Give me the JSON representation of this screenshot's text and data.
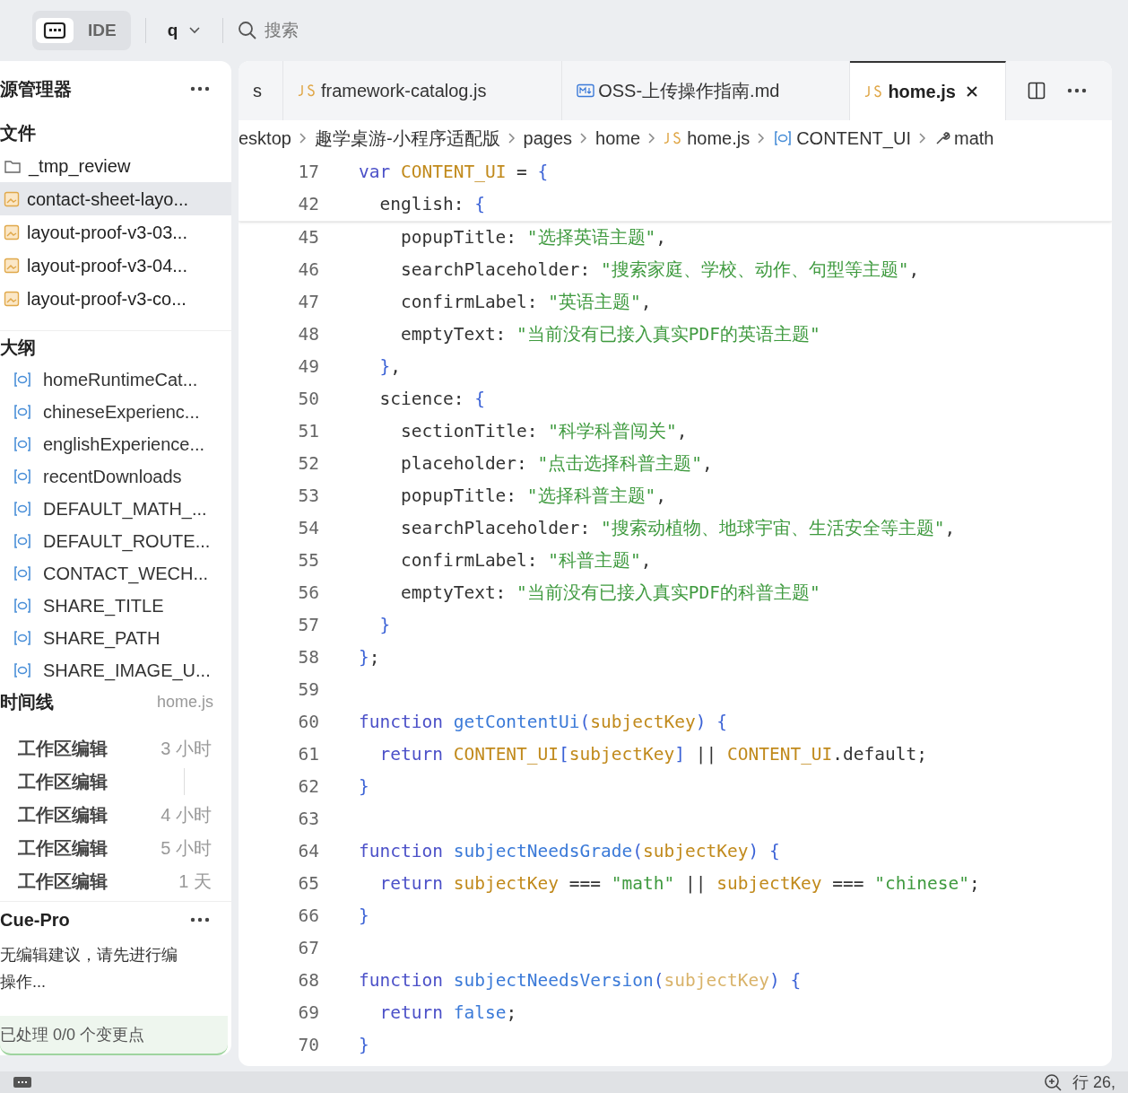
{
  "topbar": {
    "modes": [
      {
        "kind": "terminal",
        "selected": true
      },
      {
        "kind": "text",
        "label": "IDE",
        "selected": false
      }
    ],
    "workspace": "q",
    "search_placeholder": "搜索"
  },
  "explorer": {
    "title": "源管理器",
    "files_title": "文件",
    "files": [
      {
        "name": "_tmp_review",
        "kind": "folder",
        "selected": false
      },
      {
        "name": "contact-sheet-layo...",
        "kind": "image",
        "selected": true
      },
      {
        "name": "layout-proof-v3-03...",
        "kind": "image",
        "selected": false
      },
      {
        "name": "layout-proof-v3-04...",
        "kind": "image",
        "selected": false
      },
      {
        "name": "layout-proof-v3-co...",
        "kind": "image",
        "selected": false
      }
    ]
  },
  "outline": {
    "title": "大纲",
    "items": [
      "homeRuntimeCat...",
      "chineseExperienc...",
      "englishExperience...",
      "recentDownloads",
      "DEFAULT_MATH_...",
      "DEFAULT_ROUTE...",
      "CONTACT_WECH...",
      "SHARE_TITLE",
      "SHARE_PATH",
      "SHARE_IMAGE_U..."
    ]
  },
  "timeline": {
    "title": "时间线",
    "file": "home.js",
    "entries": [
      {
        "label": "工作区编辑",
        "time": "3 小时"
      },
      {
        "label": "工作区编辑"
      },
      {
        "label": "工作区编辑",
        "time": "4 小时"
      },
      {
        "label": "工作区编辑",
        "time": "5 小时"
      },
      {
        "label": "工作区编辑",
        "time": "1 天"
      }
    ]
  },
  "cue": {
    "title": "Cue-Pro",
    "message_lines": [
      "无编辑建议，请先进行编",
      "操作..."
    ],
    "status": "已处理 0/0 个变更点"
  },
  "tabs": [
    {
      "label": "s",
      "kind": "partial",
      "selected": false
    },
    {
      "label": "framework-catalog.js",
      "kind": "js",
      "selected": false
    },
    {
      "label": "OSS-上传操作指南.md",
      "kind": "md",
      "selected": false
    },
    {
      "label": "home.js",
      "kind": "js",
      "selected": true
    }
  ],
  "breadcrumb": [
    {
      "label": "esktop",
      "kind": "folder"
    },
    {
      "label": "趣学桌游-小程序适配版",
      "kind": "folder"
    },
    {
      "label": "pages",
      "kind": "folder"
    },
    {
      "label": "home",
      "kind": "folder"
    },
    {
      "label": "home.js",
      "kind": "js"
    },
    {
      "label": "CONTENT_UI",
      "kind": "variable"
    },
    {
      "label": "math",
      "kind": "property"
    }
  ],
  "sticky_lines": [
    {
      "n": "17",
      "t": [
        {
          "kind": "keyword",
          "text": "var "
        },
        {
          "kind": "constant",
          "text": "CONTENT_UI"
        },
        {
          "kind": "plain",
          "text": " = "
        },
        {
          "kind": "bracket",
          "text": "{"
        }
      ]
    },
    {
      "n": "42",
      "t": [
        {
          "kind": "plain",
          "text": "  english: "
        },
        {
          "kind": "bracket",
          "text": "{"
        }
      ]
    }
  ],
  "lines": [
    {
      "n": "45",
      "t": [
        {
          "kind": "plain",
          "text": "    popupTitle: "
        },
        {
          "kind": "string",
          "text": "\"选择英语主题\""
        },
        {
          "kind": "plain",
          "text": ","
        }
      ]
    },
    {
      "n": "46",
      "t": [
        {
          "kind": "plain",
          "text": "    searchPlaceholder: "
        },
        {
          "kind": "string",
          "text": "\"搜索家庭、学校、动作、句型等主题\""
        },
        {
          "kind": "plain",
          "text": ","
        }
      ]
    },
    {
      "n": "47",
      "t": [
        {
          "kind": "plain",
          "text": "    confirmLabel: "
        },
        {
          "kind": "string",
          "text": "\"英语主题\""
        },
        {
          "kind": "plain",
          "text": ","
        }
      ]
    },
    {
      "n": "48",
      "t": [
        {
          "kind": "plain",
          "text": "    emptyText: "
        },
        {
          "kind": "string",
          "text": "\"当前没有已接入真实PDF的英语主题\""
        }
      ]
    },
    {
      "n": "49",
      "t": [
        {
          "kind": "bracket",
          "text": "  }"
        },
        {
          "kind": "plain",
          "text": ","
        }
      ]
    },
    {
      "n": "50",
      "t": [
        {
          "kind": "plain",
          "text": "  science: "
        },
        {
          "kind": "bracket",
          "text": "{"
        }
      ]
    },
    {
      "n": "51",
      "t": [
        {
          "kind": "plain",
          "text": "    sectionTitle: "
        },
        {
          "kind": "string",
          "text": "\"科学科普闯关\""
        },
        {
          "kind": "plain",
          "text": ","
        }
      ]
    },
    {
      "n": "52",
      "t": [
        {
          "kind": "plain",
          "text": "    placeholder: "
        },
        {
          "kind": "string",
          "text": "\"点击选择科普主题\""
        },
        {
          "kind": "plain",
          "text": ","
        }
      ]
    },
    {
      "n": "53",
      "t": [
        {
          "kind": "plain",
          "text": "    popupTitle: "
        },
        {
          "kind": "string",
          "text": "\"选择科普主题\""
        },
        {
          "kind": "plain",
          "text": ","
        }
      ]
    },
    {
      "n": "54",
      "t": [
        {
          "kind": "plain",
          "text": "    searchPlaceholder: "
        },
        {
          "kind": "string",
          "text": "\"搜索动植物、地球宇宙、生活安全等主题\""
        },
        {
          "kind": "plain",
          "text": ","
        }
      ]
    },
    {
      "n": "55",
      "t": [
        {
          "kind": "plain",
          "text": "    confirmLabel: "
        },
        {
          "kind": "string",
          "text": "\"科普主题\""
        },
        {
          "kind": "plain",
          "text": ","
        }
      ]
    },
    {
      "n": "56",
      "t": [
        {
          "kind": "plain",
          "text": "    emptyText: "
        },
        {
          "kind": "string",
          "text": "\"当前没有已接入真实PDF的科普主题\""
        }
      ]
    },
    {
      "n": "57",
      "t": [
        {
          "kind": "bracket",
          "text": "  }"
        }
      ]
    },
    {
      "n": "58",
      "t": [
        {
          "kind": "bracket",
          "text": "}"
        },
        {
          "kind": "plain",
          "text": ";"
        }
      ]
    },
    {
      "n": "59"
    },
    {
      "n": "60",
      "t": [
        {
          "kind": "keyword",
          "text": "function "
        },
        {
          "kind": "function",
          "text": "getContentUi"
        },
        {
          "kind": "bracket",
          "text": "("
        },
        {
          "kind": "constant",
          "text": "subjectKey"
        },
        {
          "kind": "bracket",
          "text": ")"
        },
        {
          "kind": "bracket",
          "text": " {"
        }
      ]
    },
    {
      "n": "61",
      "t": [
        {
          "kind": "keyword",
          "text": "  return "
        },
        {
          "kind": "constant",
          "text": "CONTENT_UI"
        },
        {
          "kind": "bracket",
          "text": "["
        },
        {
          "kind": "constant",
          "text": "subjectKey"
        },
        {
          "kind": "bracket",
          "text": "]"
        },
        {
          "kind": "plain",
          "text": " || "
        },
        {
          "kind": "constant",
          "text": "CONTENT_UI"
        },
        {
          "kind": "plain",
          "text": ".default;"
        }
      ]
    },
    {
      "n": "62",
      "t": [
        {
          "kind": "bracket",
          "text": "}"
        }
      ]
    },
    {
      "n": "63"
    },
    {
      "n": "64",
      "t": [
        {
          "kind": "keyword",
          "text": "function "
        },
        {
          "kind": "function",
          "text": "subjectNeedsGrade"
        },
        {
          "kind": "bracket",
          "text": "("
        },
        {
          "kind": "constant",
          "text": "subjectKey"
        },
        {
          "kind": "bracket",
          "text": ")"
        },
        {
          "kind": "bracket",
          "text": " {"
        }
      ]
    },
    {
      "n": "65",
      "t": [
        {
          "kind": "keyword",
          "text": "  return "
        },
        {
          "kind": "constant",
          "text": "subjectKey"
        },
        {
          "kind": "plain",
          "text": " === "
        },
        {
          "kind": "string",
          "text": "\"math\""
        },
        {
          "kind": "plain",
          "text": " || "
        },
        {
          "kind": "constant",
          "text": "subjectKey"
        },
        {
          "kind": "plain",
          "text": " === "
        },
        {
          "kind": "string",
          "text": "\"chinese\""
        },
        {
          "kind": "plain",
          "text": ";"
        }
      ]
    },
    {
      "n": "66",
      "t": [
        {
          "kind": "bracket",
          "text": "}"
        }
      ]
    },
    {
      "n": "67"
    },
    {
      "n": "68",
      "t": [
        {
          "kind": "keyword",
          "text": "function "
        },
        {
          "kind": "function",
          "text": "subjectNeedsVersion"
        },
        {
          "kind": "bracket",
          "text": "("
        },
        {
          "kind": "unused",
          "text": "subjectKey"
        },
        {
          "kind": "bracket",
          "text": ")"
        },
        {
          "kind": "bracket",
          "text": " {"
        }
      ]
    },
    {
      "n": "69",
      "t": [
        {
          "kind": "keyword",
          "text": "  return "
        },
        {
          "kind": "literal",
          "text": "false"
        },
        {
          "kind": "plain",
          "text": ";"
        }
      ]
    },
    {
      "n": "70",
      "t": [
        {
          "kind": "bracket",
          "text": "}"
        }
      ]
    }
  ],
  "status_bar": {
    "position": "行 26,"
  }
}
